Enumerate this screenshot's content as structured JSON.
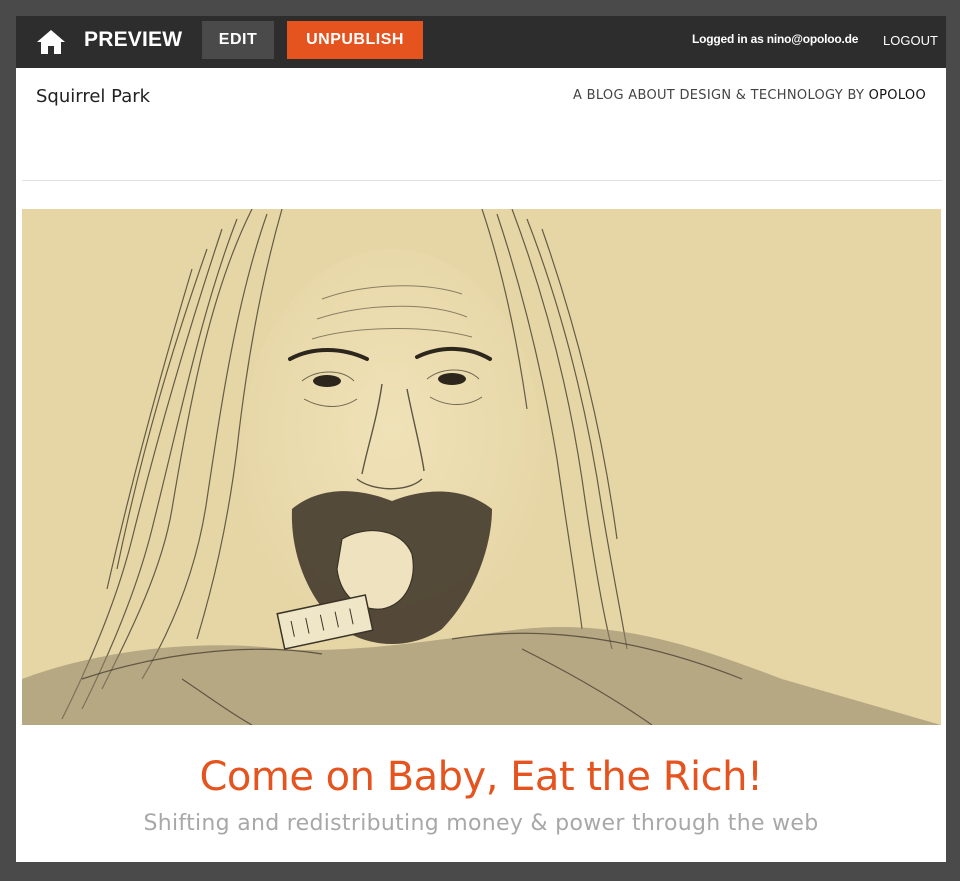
{
  "toolbar": {
    "home_icon": "home-icon",
    "preview_label": "PREVIEW",
    "edit_label": "EDIT",
    "unpublish_label": "UNPUBLISH",
    "logged_in_text": "Logged in as nino@opoloo.de",
    "logout_label": "LOGOUT",
    "unpublish_color": "#e5531f"
  },
  "blog": {
    "site_name": "Squirrel Park",
    "tagline_prefix": "A BLOG ABOUT DESIGN & TECHNOLOGY BY ",
    "tagline_author": "OPOLOO"
  },
  "post": {
    "hero_image": "pencil-sketch-portrait",
    "title": "Come on Baby, Eat the Rich!",
    "subtitle": "Shifting and redistributing money & power through the web",
    "title_color": "#e5531f"
  }
}
